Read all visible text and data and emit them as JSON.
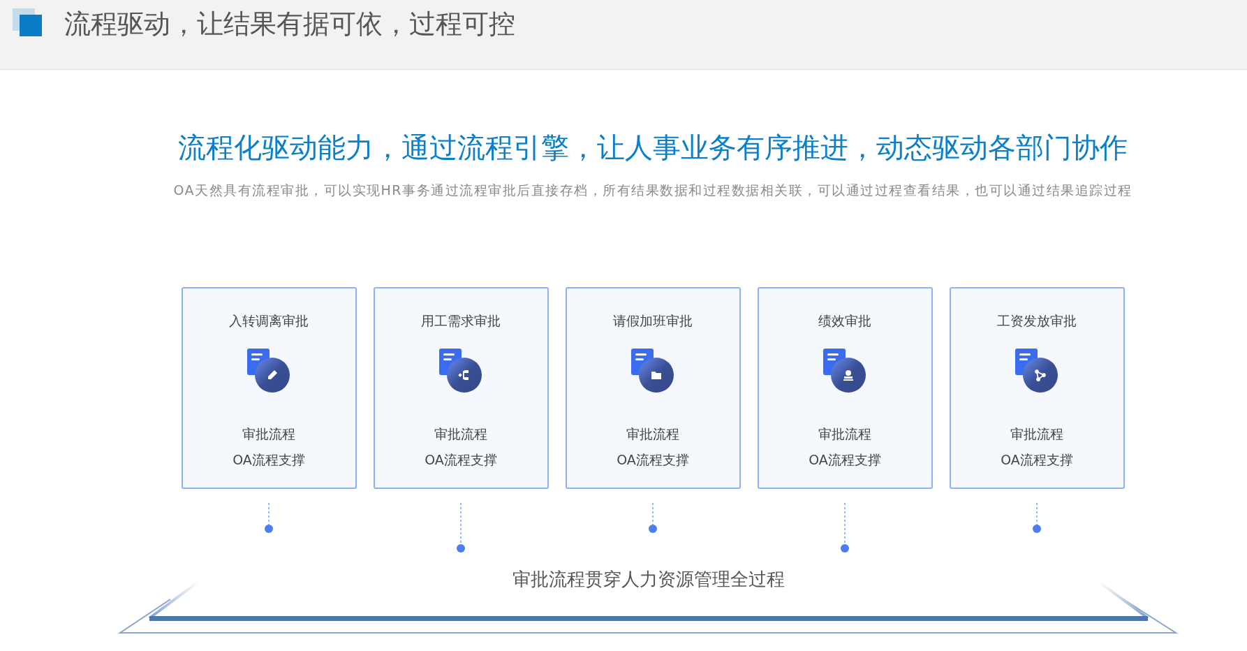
{
  "header": {
    "title": "流程驱动，让结果有据可依，过程可控"
  },
  "headline": "流程化驱动能力，通过流程引擎，让人事业务有序推进，动态驱动各部门协作",
  "description": "OA天然具有流程审批，可以实现HR事务通过流程审批后直接存档，所有结果数据和过程数据相关联，可以通过过程查看结果，也可以通过结果追踪过程",
  "cards": [
    {
      "title": "入转调离审批",
      "line_1": "审批流程",
      "line_2": "OA流程支撑"
    },
    {
      "title": "用工需求审批",
      "line_1": "审批流程",
      "line_2": "OA流程支撑"
    },
    {
      "title": "请假加班审批",
      "line_1": "审批流程",
      "line_2": "OA流程支撑"
    },
    {
      "title": "绩效审批",
      "line_1": "审批流程",
      "line_2": "OA流程支撑"
    },
    {
      "title": "工资发放审批",
      "line_1": "审批流程",
      "line_2": "OA流程支撑"
    }
  ],
  "platform_caption": "审批流程贯穿人力资源管理全过程"
}
